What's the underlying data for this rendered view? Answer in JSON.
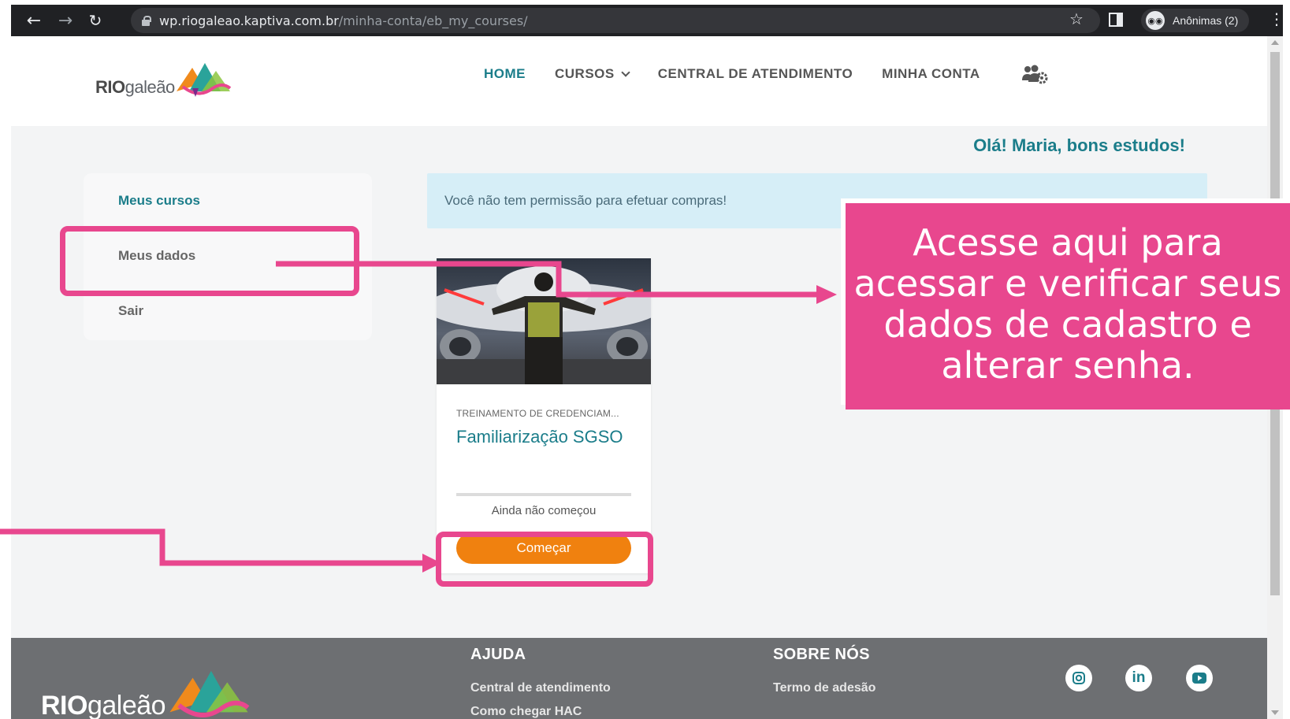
{
  "browser": {
    "url_host": "wp.riogaleao.kaptiva.com.br",
    "url_path": "/minha-conta/eb_my_courses/",
    "profile_label": "Anônimas (2)"
  },
  "header": {
    "logo_bold": "RIO",
    "logo_light": "galeão",
    "nav": [
      "HOME",
      "CURSOS",
      "CENTRAL DE ATENDIMENTO",
      "MINHA CONTA"
    ]
  },
  "greeting": "Olá! Maria, bons estudos!",
  "sidebar": {
    "items": [
      "Meus cursos",
      "Meus dados",
      "Sair"
    ]
  },
  "alert": "Você não tem permissão para efetuar compras!",
  "course": {
    "category": "TREINAMENTO DE CREDENCIAM...",
    "title": "Familiarização SGSO",
    "progress": 0,
    "status": "Ainda não começou",
    "button": "Começar"
  },
  "footer": {
    "logo_bold": "RIO",
    "logo_light": "galeão",
    "col1_heading": "AJUDA",
    "col1_links": [
      "Central de atendimento",
      "Como chegar HAC"
    ],
    "col2_heading": "SOBRE NÓS",
    "col2_links": [
      "Termo de adesão"
    ],
    "social": [
      "instagram-icon",
      "linkedin-icon",
      "youtube-icon"
    ]
  },
  "annotation": {
    "callout_text": "Acesse aqui para acessar e verificar seus dados de cadastro e alterar senha.",
    "color": "#e8478e"
  },
  "colors": {
    "brand_teal": "#1b7d8a",
    "button_orange": "#f0810f",
    "footer_gray": "#6d6f72"
  }
}
